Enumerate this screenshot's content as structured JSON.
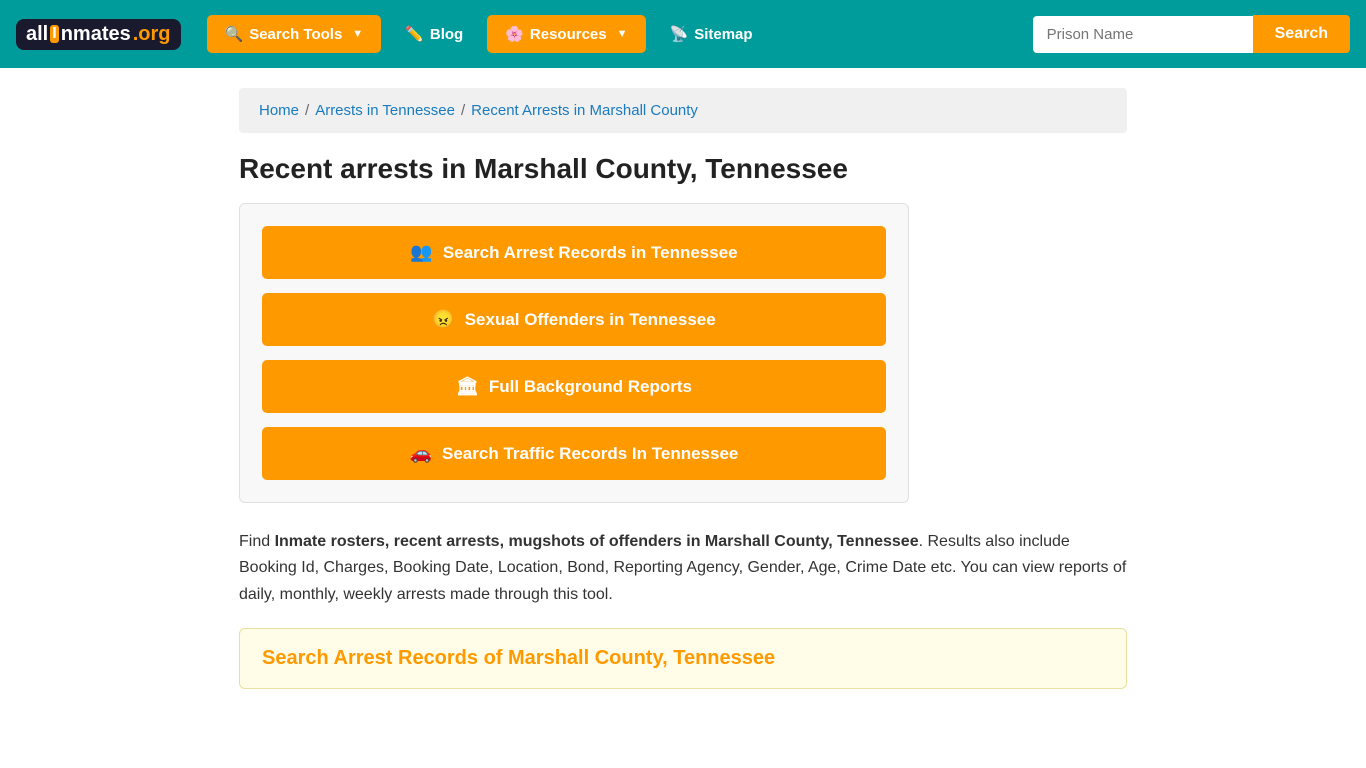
{
  "navbar": {
    "logo": {
      "part1": "all",
      "part2": "I",
      "part3": "nmates",
      "part4": ".org"
    },
    "search_tools_label": "Search Tools",
    "blog_label": "Blog",
    "resources_label": "Resources",
    "sitemap_label": "Sitemap",
    "search_placeholder": "Prison Name",
    "search_btn_label": "Search"
  },
  "breadcrumb": {
    "home": "Home",
    "arrests_tn": "Arrests in Tennessee",
    "current": "Recent Arrests in Marshall County"
  },
  "page": {
    "title": "Recent arrests in Marshall County, Tennessee",
    "description_part1": "Find ",
    "description_bold": "Inmate rosters, recent arrests, mugshots of offenders in Marshall County, Tennessee",
    "description_part2": ". Results also include Booking Id, Charges, Booking Date, Location, Bond, Reporting Agency, Gender, Age, Crime Date etc. You can view reports of daily, monthly, weekly arrests made through this tool.",
    "search_section_title": "Search Arrest Records of Marshall County, Tennessee"
  },
  "action_buttons": [
    {
      "id": "search-arrest",
      "icon": "👥",
      "label": "Search Arrest Records in Tennessee"
    },
    {
      "id": "sexual-offenders",
      "icon": "😠",
      "label": "Sexual Offenders in Tennessee"
    },
    {
      "id": "background-reports",
      "icon": "🏛",
      "label": "Full Background Reports"
    },
    {
      "id": "traffic-records",
      "icon": "🚗",
      "label": "Search Traffic Records In Tennessee"
    }
  ],
  "icons": {
    "search_tools": "🔍",
    "blog": "✏️",
    "resources": "🌸",
    "sitemap": "📡"
  }
}
